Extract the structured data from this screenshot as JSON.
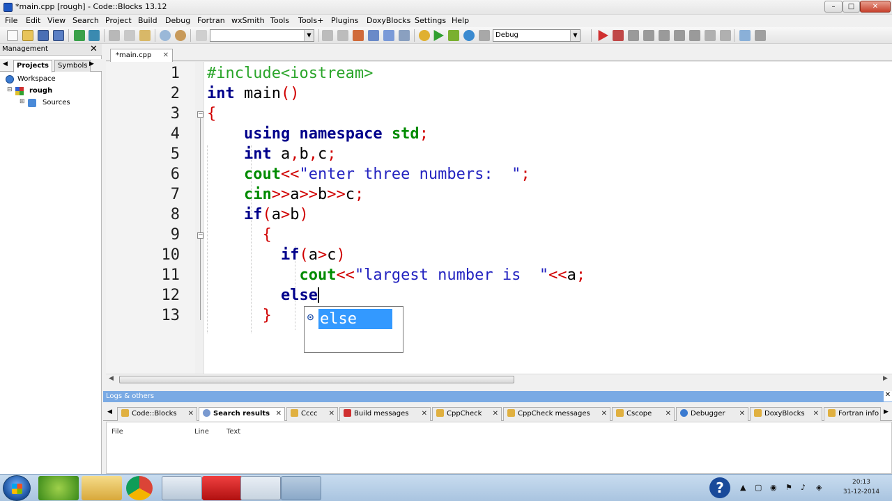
{
  "window": {
    "title": "*main.cpp [rough] - Code::Blocks 13.12",
    "min": "–",
    "max": "□",
    "close": "✕"
  },
  "menu": [
    "File",
    "Edit",
    "View",
    "Search",
    "Project",
    "Build",
    "Debug",
    "Fortran",
    "wxSmith",
    "Tools",
    "Tools+",
    "Plugins",
    "DoxyBlocks",
    "Settings",
    "Help"
  ],
  "toolbar": {
    "search_value": "",
    "build_target": "Debug"
  },
  "management": {
    "title": "Management",
    "close": "✕",
    "tabs": [
      "Projects",
      "Symbols"
    ],
    "tree": {
      "workspace": "Workspace",
      "project": "rough",
      "sources": "Sources"
    }
  },
  "editor": {
    "tab_label": "*main.cpp",
    "tab_close": "✕",
    "line_numbers": [
      "1",
      "2",
      "3",
      "4",
      "5",
      "6",
      "7",
      "8",
      "9",
      "10",
      "11",
      "12",
      "13"
    ],
    "code": {
      "l1": "#include<iostream>",
      "l2_kw": "int",
      "l2_rest": " main",
      "l2_paren": "()",
      "l3": "{",
      "l4_a": "using",
      "l4_b": "namespace",
      "l4_c": "std",
      "l4_d": ";",
      "l5_kw": "int",
      "l5_rest": " a",
      "l5_c1": ",",
      "l5_b": "b",
      "l5_c2": ",",
      "l5_c": "c",
      "l5_semi": ";",
      "l6_a": "cout",
      "l6_op": "<<",
      "l6_str": "\"enter three numbers:  \"",
      "l6_semi": ";",
      "l7_a": "cin",
      "l7_op1": ">>",
      "l7_b": "a",
      "l7_op2": ">>",
      "l7_c": "b",
      "l7_op3": ">>",
      "l7_d": "c",
      "l7_semi": ";",
      "l8_kw": "if",
      "l8_p1": "(",
      "l8_a": "a",
      "l8_gt": ">",
      "l8_b": "b",
      "l8_p2": ")",
      "l9": "{",
      "l10_kw": "if",
      "l10_p1": "(",
      "l10_a": "a",
      "l10_gt": ">",
      "l10_b": "c",
      "l10_p2": ")",
      "l11_a": "cout",
      "l11_op": "<<",
      "l11_str": "\"largest number is  \"",
      "l11_op2": "<<",
      "l11_b": "a",
      "l11_semi": ";",
      "l12": "else",
      "l13": "}"
    },
    "autocomplete": {
      "icon": "⊙",
      "item": "else"
    }
  },
  "logs": {
    "title": "Logs & others",
    "close": "✕",
    "tabs": [
      "Code::Blocks",
      "Search results",
      "Cccc",
      "Build messages",
      "CppCheck",
      "CppCheck messages",
      "Cscope",
      "Debugger",
      "DoxyBlocks",
      "Fortran info"
    ],
    "columns": [
      "File",
      "Line",
      "Text"
    ]
  },
  "taskbar": {
    "clock_time": "20:13",
    "clock_date": "31-12-2014",
    "help_glyph": "?"
  },
  "colors": {
    "keyword": "#00008b",
    "preprocessor": "#2aa52a",
    "operator": "#d00000",
    "string": "#2323c0",
    "selection": "#3399ff"
  }
}
